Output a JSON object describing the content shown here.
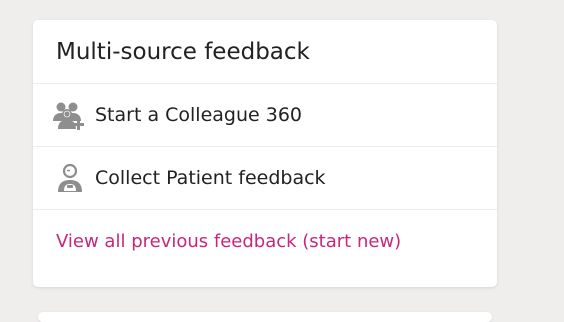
{
  "card": {
    "title": "Multi-source feedback",
    "items": [
      {
        "label": "Start a Colleague 360",
        "icon": "colleagues-add-icon"
      },
      {
        "label": "Collect Patient feedback",
        "icon": "patient-icon"
      }
    ],
    "link_label": "View all previous feedback (start new)"
  },
  "colors": {
    "background": "#efeeed",
    "card": "#ffffff",
    "text": "#222222",
    "link": "#c8267a",
    "icon": "#8e8e8e"
  }
}
